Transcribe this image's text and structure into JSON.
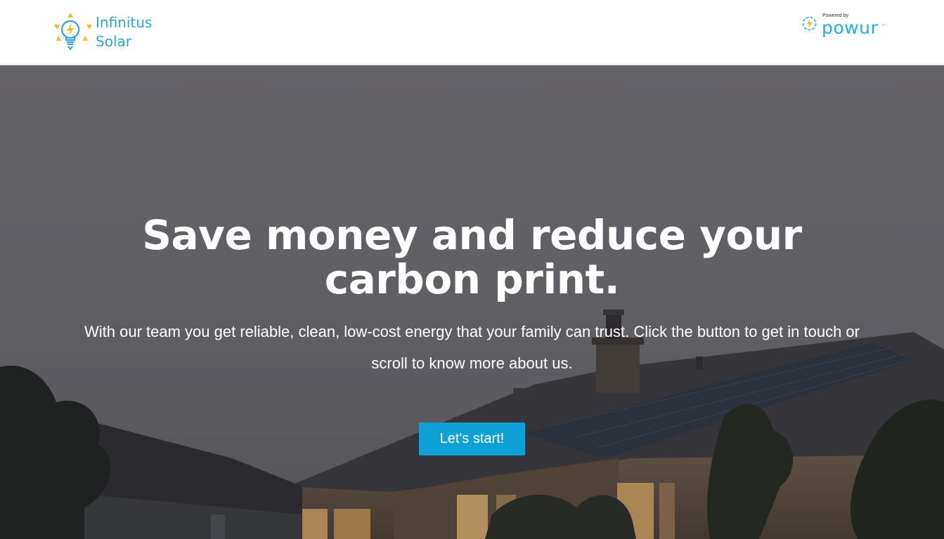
{
  "header": {
    "brand": {
      "line1": "Infinitus",
      "line2": "Solar",
      "icon": "lightbulb-sun-icon",
      "color": "#2aa6dc",
      "accent": "#f5b829"
    },
    "partner": {
      "powered_by": "Powered by",
      "name": "powur",
      "trademark": "™",
      "icon": "sun-bolt-icon",
      "color": "#1bb6e0"
    }
  },
  "hero": {
    "title": "Save money and reduce your carbon print.",
    "subtitle": "With our team you get reliable, clean, low-cost energy that your family can trust. Click the button to get in touch or scroll to know more about us.",
    "cta_label": "Let's start!",
    "cta_color": "#0fa0d6",
    "background": "house-with-solar-roof-at-dusk"
  }
}
